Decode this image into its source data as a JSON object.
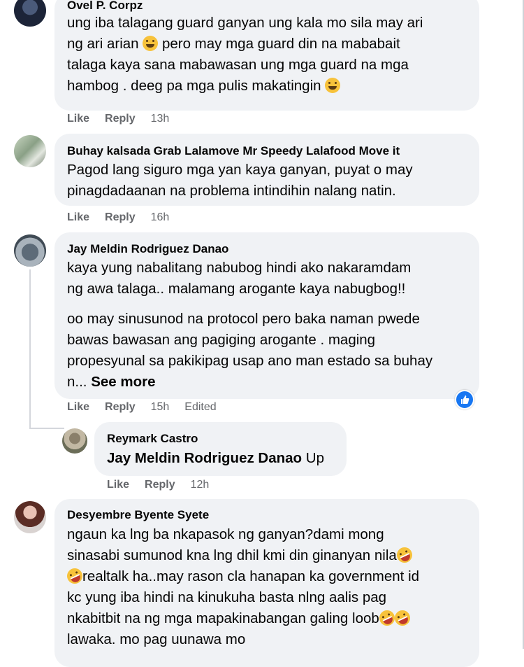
{
  "comments": [
    {
      "author": "Ovel P. Corpz",
      "lines": [
        "ung iba talagang guard ganyan ung kala mo sila may ari",
        "ng ari arian ",
        "talaga kaya sana mabawasan ung mga guard na mga",
        "hambog . deeg pa mga pulis makatingin "
      ],
      "line2_suffix": " pero may mga guard din na mababait",
      "like": "Like",
      "reply": "Reply",
      "time": "13h"
    },
    {
      "author": "Buhay kalsada Grab Lalamove Mr Speedy Lalafood Move it",
      "lines": [
        "Pagod lang siguro mga yan kaya ganyan, puyat o may",
        "pinagdadaanan na problema intindihin nalang natin."
      ],
      "like": "Like",
      "reply": "Reply",
      "time": "16h"
    },
    {
      "author": "Jay Meldin Rodriguez Danao",
      "lines": [
        "kaya yung nabalitang nabubog hindi ako nakaramdam",
        "ng awa talaga.. malamang arogante kaya nabugbog!!"
      ],
      "lines2": [
        "oo may sinusunod na protocol pero baka naman pwede",
        "bawas bawasan ang pagiging arogante . maging",
        "propesyunal sa pakikipag usap ano man estado sa buhay",
        "n... "
      ],
      "see_more": "See more",
      "like": "Like",
      "reply": "Reply",
      "time": "15h",
      "edited": "Edited"
    },
    {
      "author": "Reymark Castro",
      "mention": "Jay Meldin Rodriguez Danao",
      "text": " Up",
      "like": "Like",
      "reply": "Reply",
      "time": "12h"
    },
    {
      "author": "Desyembre Byente Syete",
      "lines": [
        "ngaun ka lng ba nkapasok ng ganyan?dami mong",
        "sinasabi sumunod kna lng dhil kmi din ginanyan nila",
        "realtalk ha..may rason cla hanapan ka government id",
        "kc yung iba hindi na kinukuha basta nlng aalis pag",
        "nkabitbit na ng mga mapakinabangan galing loob",
        "lawaka. mo pag uunawa mo"
      ]
    }
  ]
}
